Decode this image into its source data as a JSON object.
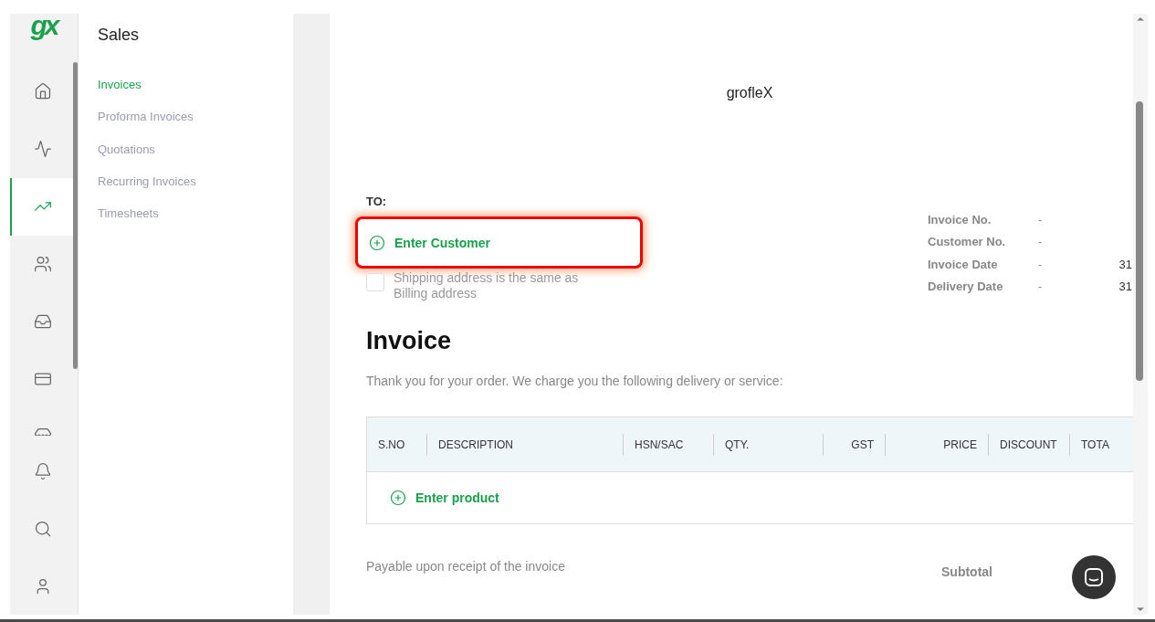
{
  "logo": {
    "text": "gx"
  },
  "rail": {
    "items": [
      {
        "kind": "home",
        "selected": false
      },
      {
        "kind": "activity",
        "selected": false
      },
      {
        "kind": "trend",
        "selected": true
      },
      {
        "kind": "users",
        "selected": false
      },
      {
        "kind": "inbox",
        "selected": false
      },
      {
        "kind": "card",
        "selected": false
      },
      {
        "kind": "store",
        "selected": false
      }
    ],
    "bottom": [
      {
        "kind": "bell"
      },
      {
        "kind": "search"
      },
      {
        "kind": "user"
      }
    ]
  },
  "subnav": {
    "title": "Sales",
    "items": [
      {
        "label": "Invoices",
        "selected": true
      },
      {
        "label": "Proforma Invoices",
        "selected": false
      },
      {
        "label": "Quotations",
        "selected": false
      },
      {
        "label": "Recurring Invoices",
        "selected": false
      },
      {
        "label": "Timesheets",
        "selected": false
      }
    ]
  },
  "document": {
    "company": "grofleX",
    "to_label": "TO:",
    "customer": {
      "label": "Enter Customer",
      "highlighted": true
    },
    "same_address": {
      "label": "Shipping address is the same as Billing address",
      "checked": false
    },
    "meta": [
      {
        "label": "Invoice No.",
        "sep": "-"
      },
      {
        "label": "Customer No.",
        "sep": "-"
      },
      {
        "label": "Invoice Date",
        "sep": "-",
        "value": "31"
      },
      {
        "label": "Delivery Date",
        "sep": "-",
        "value": "31"
      }
    ],
    "title": "Invoice",
    "intro": "Thank you for your order. We charge you the following delivery or service:",
    "table": {
      "columns": [
        "S.NO",
        "DESCRIPTION",
        "HSN/SAC",
        "QTY.",
        "GST",
        "PRICE",
        "DISCOUNT",
        "TOTA"
      ],
      "add_label": "Enter product"
    },
    "payment_note": "Payable upon receipt of the invoice",
    "subtotal_label": "Subtotal"
  }
}
